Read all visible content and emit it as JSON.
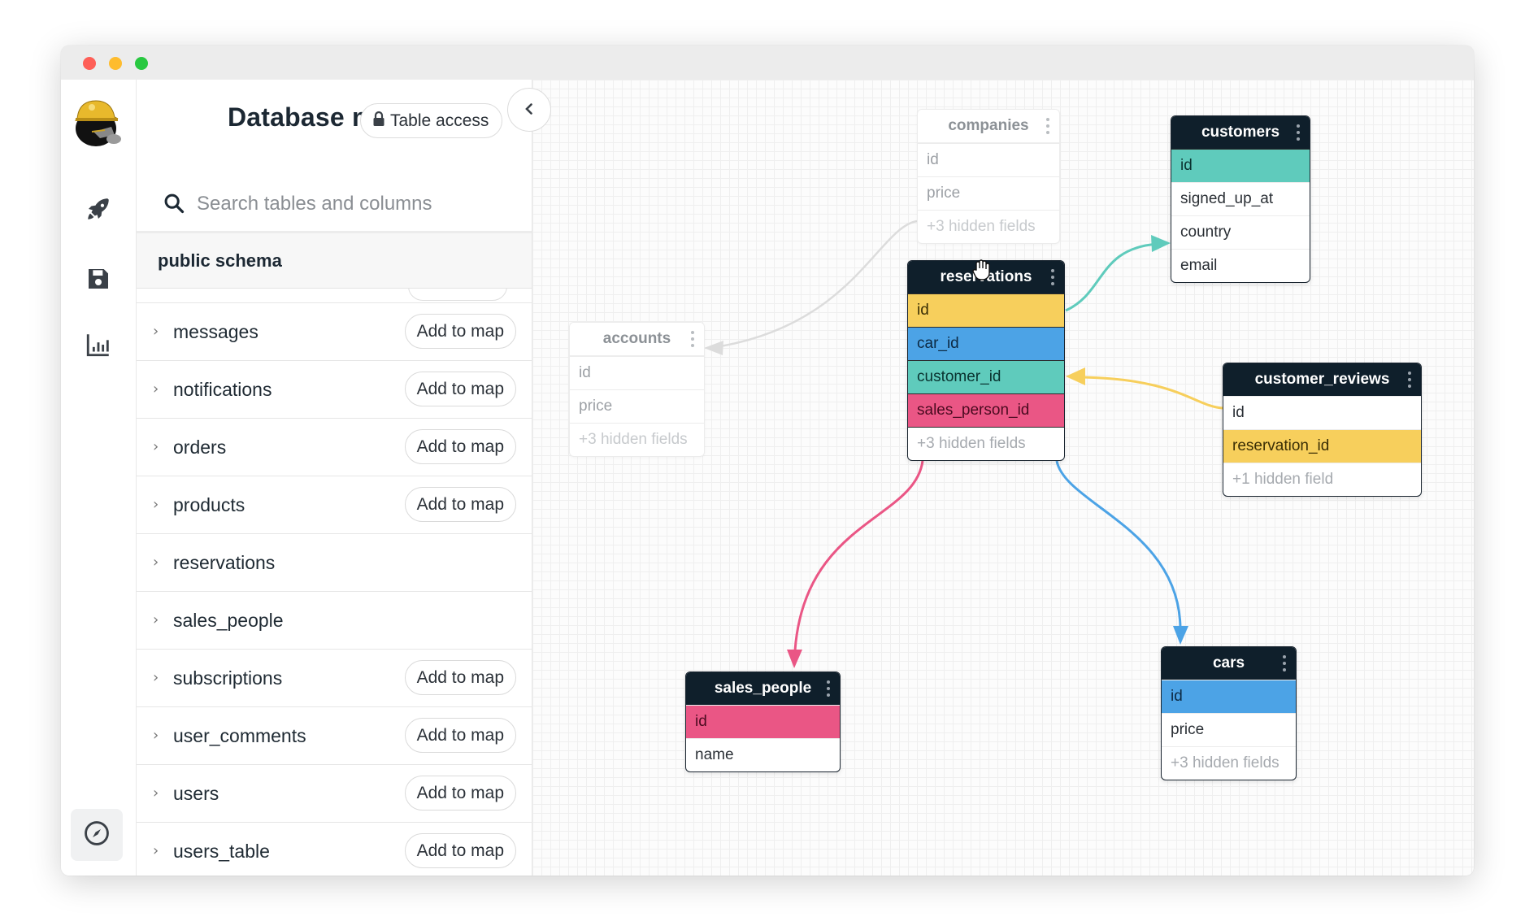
{
  "window": {
    "controls": [
      "close",
      "minimize",
      "maximize"
    ]
  },
  "rail": {
    "logo": "miner-mascot-logo",
    "items": [
      {
        "icon": "rocket-icon"
      },
      {
        "icon": "save-icon"
      },
      {
        "icon": "bar-chart-icon"
      }
    ],
    "bottom_icon": "compass-icon"
  },
  "panel": {
    "title": "Database map",
    "access_button": "Table access",
    "collapse_icon": "chevron-left-icon",
    "search": {
      "placeholder": "Search tables and columns",
      "value": ""
    },
    "schema_label": "public schema",
    "tables": [
      {
        "name": "messages",
        "action": "Add to map"
      },
      {
        "name": "notifications",
        "action": "Add to map"
      },
      {
        "name": "orders",
        "action": "Add to map"
      },
      {
        "name": "products",
        "action": "Add to map"
      },
      {
        "name": "reservations",
        "action": null
      },
      {
        "name": "sales_people",
        "action": null
      },
      {
        "name": "subscriptions",
        "action": "Add to map"
      },
      {
        "name": "user_comments",
        "action": "Add to map"
      },
      {
        "name": "users",
        "action": "Add to map"
      },
      {
        "name": "users_table",
        "action": "Add to map"
      }
    ]
  },
  "colors": {
    "yellow": "#f7cf5c",
    "blue": "#4ca3e6",
    "teal": "#5fcbbc",
    "pink": "#ea5685",
    "gray_edge": "#dcdcdc",
    "header_dark": "#0f1f2b"
  },
  "map": {
    "tables": {
      "companies": {
        "title": "companies",
        "faded": true,
        "fields": [
          {
            "name": "id"
          },
          {
            "name": "price"
          }
        ],
        "hidden": "+3 hidden fields"
      },
      "customers": {
        "title": "customers",
        "faded": false,
        "fields": [
          {
            "name": "id",
            "color": "teal"
          },
          {
            "name": "signed_up_at"
          },
          {
            "name": "country"
          },
          {
            "name": "email"
          }
        ],
        "hidden": null
      },
      "reservations": {
        "title": "reservations",
        "faded": false,
        "fields": [
          {
            "name": "id",
            "color": "yellow"
          },
          {
            "name": "car_id",
            "color": "blue"
          },
          {
            "name": "customer_id",
            "color": "teal"
          },
          {
            "name": "sales_person_id",
            "color": "pink"
          }
        ],
        "hidden": "+3 hidden fields"
      },
      "accounts": {
        "title": "accounts",
        "faded": true,
        "fields": [
          {
            "name": "id"
          },
          {
            "name": "price"
          }
        ],
        "hidden": "+3 hidden fields"
      },
      "customer_reviews": {
        "title": "customer_reviews",
        "faded": false,
        "fields": [
          {
            "name": "id"
          },
          {
            "name": "reservation_id",
            "color": "yellow"
          }
        ],
        "hidden": "+1 hidden field"
      },
      "sales_people": {
        "title": "sales_people",
        "faded": false,
        "fields": [
          {
            "name": "id",
            "color": "pink"
          },
          {
            "name": "name"
          }
        ],
        "hidden": null
      },
      "cars": {
        "title": "cars",
        "faded": false,
        "fields": [
          {
            "name": "id",
            "color": "blue"
          },
          {
            "name": "price"
          }
        ],
        "hidden": "+3 hidden fields"
      }
    },
    "relations": [
      {
        "from": "companies",
        "to": "accounts",
        "color": "gray"
      },
      {
        "from": "reservations.id",
        "to": "customers.country",
        "color": "teal"
      },
      {
        "from": "customer_reviews.reservation_id",
        "to": "reservations.customer_id",
        "color": "yellow"
      },
      {
        "from": "reservations.sales_person_id",
        "to": "sales_people.id",
        "color": "pink"
      },
      {
        "from": "reservations.car_id",
        "to": "cars.id",
        "color": "blue"
      }
    ]
  }
}
